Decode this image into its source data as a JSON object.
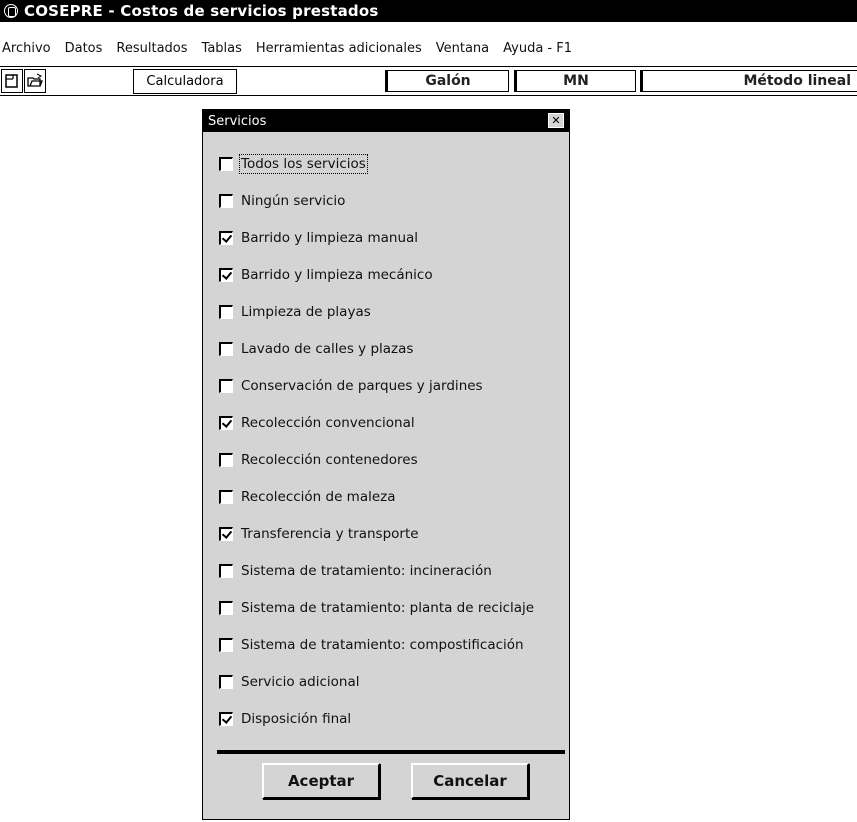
{
  "window": {
    "title": "COSEPRE  -  Costos de servicios prestados"
  },
  "menu": [
    {
      "label": "Archivo"
    },
    {
      "label": "Datos"
    },
    {
      "label": "Resultados"
    },
    {
      "label": "Tablas"
    },
    {
      "label": "Herramientas adicionales"
    },
    {
      "label": "Ventana"
    },
    {
      "label": "Ayuda - F1"
    }
  ],
  "toolbar": {
    "icons": [
      "new-document-icon",
      "open-folder-icon"
    ],
    "calculator_label": "Calculadora",
    "status_unit": "Galón",
    "status_currency": "MN",
    "status_method": "Método lineal"
  },
  "dialog": {
    "title": "Servicios",
    "options": [
      {
        "label": "Todos los servicios",
        "checked": false
      },
      {
        "label": "Ningún servicio",
        "checked": false
      },
      {
        "label": "Barrido y limpieza manual",
        "checked": true
      },
      {
        "label": "Barrido y limpieza mecánico",
        "checked": true
      },
      {
        "label": "Limpieza de playas",
        "checked": false
      },
      {
        "label": "Lavado de calles y plazas",
        "checked": false
      },
      {
        "label": "Conservación de parques y jardines",
        "checked": false
      },
      {
        "label": "Recolección convencional",
        "checked": true
      },
      {
        "label": "Recolección contenedores",
        "checked": false
      },
      {
        "label": "Recolección de maleza",
        "checked": false
      },
      {
        "label": "Transferencia y transporte",
        "checked": true
      },
      {
        "label": "Sistema de tratamiento: incineración",
        "checked": false
      },
      {
        "label": "Sistema de tratamiento: planta de reciclaje",
        "checked": false
      },
      {
        "label": "Sistema de tratamiento: compostificación",
        "checked": false
      },
      {
        "label": "Servicio adicional",
        "checked": false
      },
      {
        "label": "Disposición final",
        "checked": true
      }
    ],
    "accept_label": "Aceptar",
    "cancel_label": "Cancelar"
  }
}
